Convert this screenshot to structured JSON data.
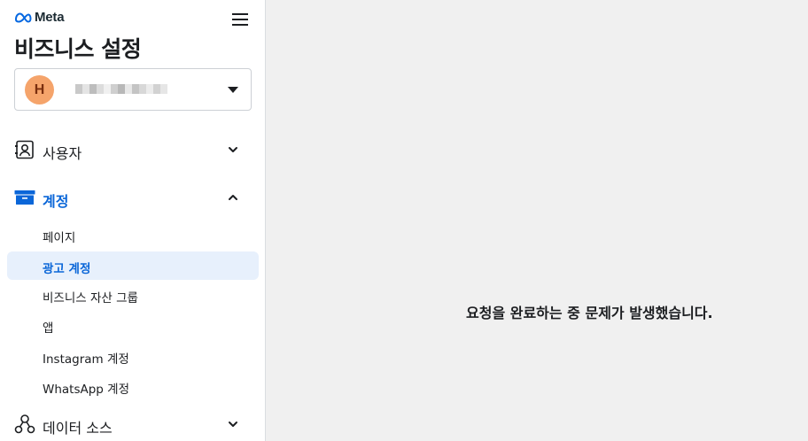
{
  "brand": {
    "name": "Meta",
    "logo_icon": "meta-infinity-icon",
    "logo_color": "#0668E1"
  },
  "header": {
    "title": "비즈니스 설정",
    "menu_icon": "hamburger-menu-icon"
  },
  "account_selector": {
    "avatar_initial": "H",
    "avatar_color": "#F5A46B",
    "caret_icon": "caret-down-icon"
  },
  "sidebar": {
    "sections": [
      {
        "label": "사용자",
        "icon": "user-card-icon",
        "expanded": false,
        "chevron_icon": "chevron-down-icon"
      },
      {
        "label": "계정",
        "icon": "archive-box-icon",
        "expanded": true,
        "active_color": "#0A66D8",
        "chevron_icon": "chevron-up-icon",
        "items": [
          {
            "label": "페이지",
            "active": false
          },
          {
            "label": "광고 계정",
            "active": true
          },
          {
            "label": "비즈니스 자산 그룹",
            "active": false
          },
          {
            "label": "앱",
            "active": false
          },
          {
            "label": "Instagram 계정",
            "active": false
          },
          {
            "label": "WhatsApp 계정",
            "active": false
          }
        ]
      },
      {
        "label": "데이터 소스",
        "icon": "data-sources-icon",
        "expanded": false,
        "chevron_icon": "chevron-down-icon"
      }
    ]
  },
  "main": {
    "error_message": "요청을 완료하는 중 문제가 발생했습니다.",
    "background": "#F0F0F0"
  }
}
